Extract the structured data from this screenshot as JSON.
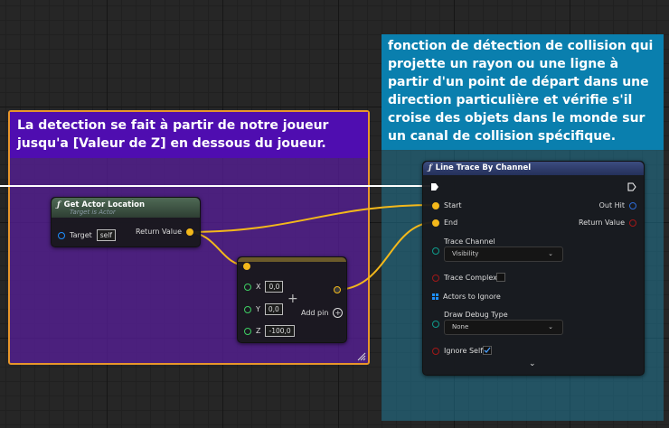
{
  "comments": {
    "purple": "La detection se fait à partir de notre joueur jusqu'a [Valeur de Z] en dessous du joueur.",
    "blue": "fonction de détection de collision qui projette un rayon ou une ligne à partir d'un point de départ dans une direction particulière et vérifie s'il croise des objets dans le monde sur un canal de collision spécifique."
  },
  "get_actor_location": {
    "title": "Get Actor Location",
    "subtitle": "Target is Actor",
    "target_label": "Target",
    "target_value": "self",
    "return_label": "Return Value"
  },
  "make_vector": {
    "x_label": "X",
    "x_value": "0,0",
    "y_label": "Y",
    "y_value": "0,0",
    "z_label": "Z",
    "z_value": "-100,0",
    "add_pin": "Add pin"
  },
  "line_trace": {
    "title": "Line Trace By Channel",
    "start": "Start",
    "end": "End",
    "out_hit": "Out Hit",
    "return_value": "Return Value",
    "trace_channel_label": "Trace Channel",
    "trace_channel_value": "Visibility",
    "trace_complex": "Trace Complex",
    "actors_to_ignore": "Actors to Ignore",
    "draw_debug_label": "Draw Debug Type",
    "draw_debug_value": "None",
    "ignore_self": "Ignore Self",
    "ignore_self_checked": true
  },
  "colors": {
    "exec": "#ffffff",
    "vector": "#f3b81b",
    "float": "#3ecf63",
    "object": "#1e8fff",
    "bool": "#a11818",
    "struct": "#2d6bd6",
    "comment_border": "#e8962a"
  }
}
